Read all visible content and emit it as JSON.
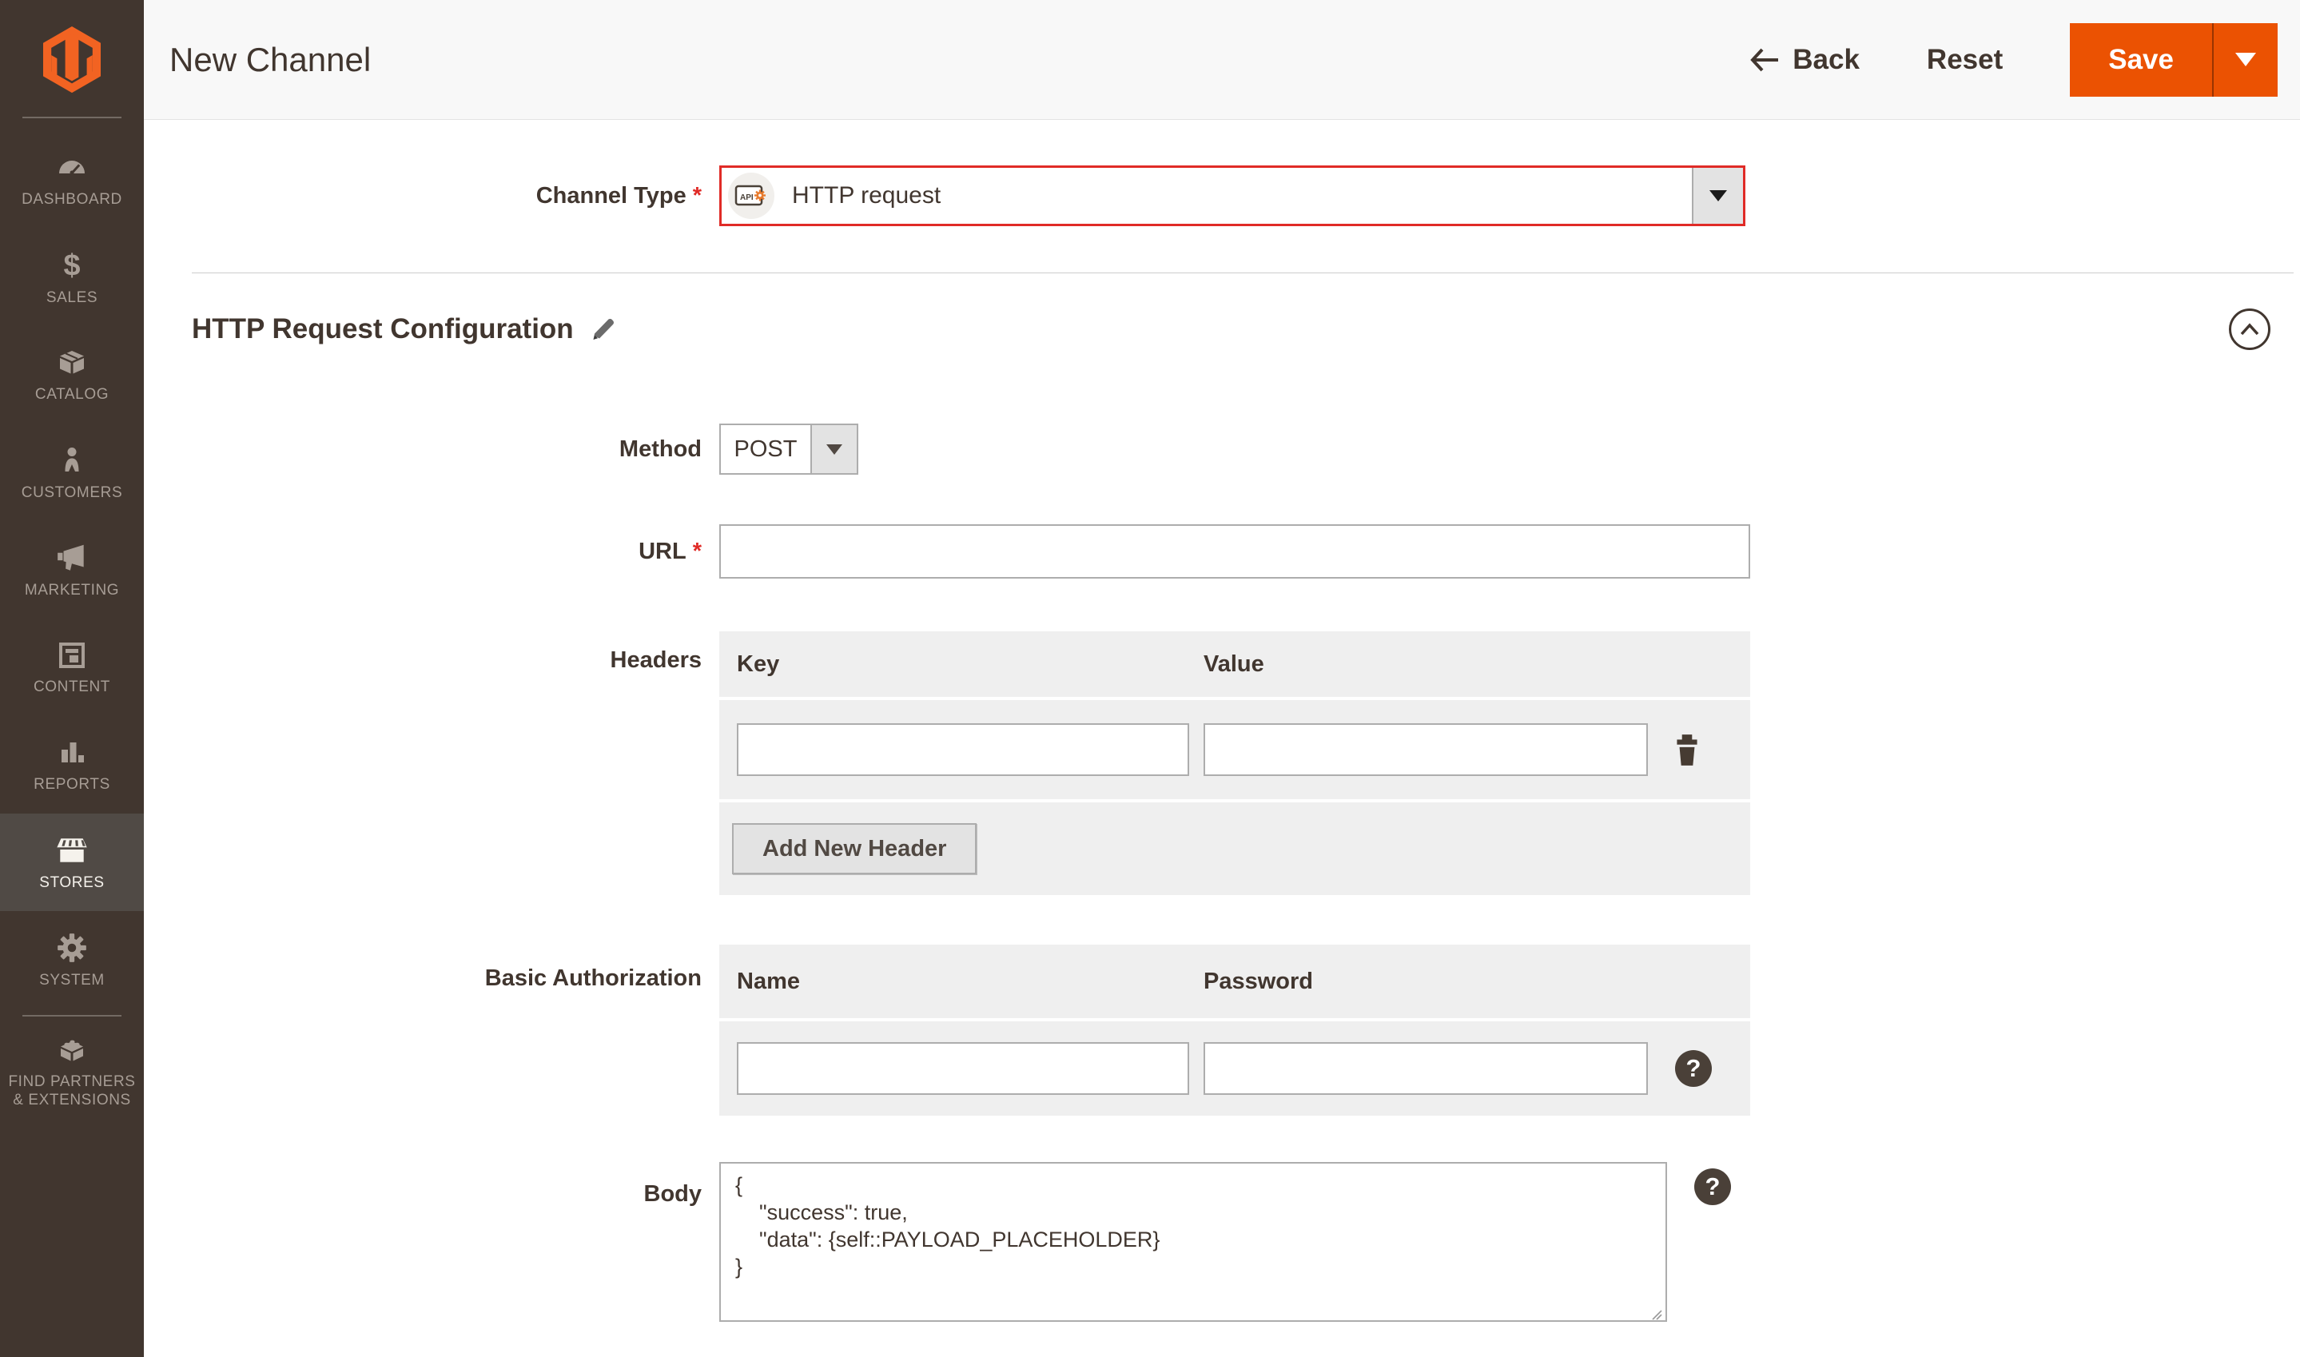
{
  "sidebar": {
    "items": [
      {
        "label": "DASHBOARD",
        "icon": "dashboard-icon",
        "active": false
      },
      {
        "label": "SALES",
        "icon": "sales-icon",
        "active": false
      },
      {
        "label": "CATALOG",
        "icon": "catalog-icon",
        "active": false
      },
      {
        "label": "CUSTOMERS",
        "icon": "customers-icon",
        "active": false
      },
      {
        "label": "MARKETING",
        "icon": "marketing-icon",
        "active": false
      },
      {
        "label": "CONTENT",
        "icon": "content-icon",
        "active": false
      },
      {
        "label": "REPORTS",
        "icon": "reports-icon",
        "active": false
      },
      {
        "label": "STORES",
        "icon": "stores-icon",
        "active": true
      },
      {
        "label": "SYSTEM",
        "icon": "system-icon",
        "active": false
      },
      {
        "label": "FIND PARTNERS & EXTENSIONS",
        "icon": "extensions-icon",
        "active": false
      }
    ]
  },
  "header": {
    "title": "New Channel",
    "back": "Back",
    "reset": "Reset",
    "save": "Save"
  },
  "form": {
    "channel_type": {
      "label": "Channel Type",
      "required": "*",
      "value": "HTTP request",
      "icon_badge": "API"
    },
    "section_title": "HTTP Request Configuration",
    "method": {
      "label": "Method",
      "value": "POST"
    },
    "url": {
      "label": "URL",
      "required": "*",
      "value": ""
    },
    "headers": {
      "label": "Headers",
      "columns": {
        "key": "Key",
        "value": "Value"
      },
      "rows": [
        {
          "key": "",
          "value": ""
        }
      ],
      "add_button": "Add New Header"
    },
    "basic_authorization": {
      "label": "Basic Authorization",
      "columns": {
        "name": "Name",
        "password": "Password"
      },
      "name_value": "",
      "password_value": "",
      "help_icon": "?"
    },
    "body": {
      "label": "Body",
      "value": "{\n    \"success\": true,\n    \"data\": {self::PAYLOAD_PLACEHOLDER}\n}",
      "help_icon": "?"
    }
  },
  "colors": {
    "accent_orange": "#eb5202",
    "logo_orange": "#f26322",
    "error_red": "#e02b27",
    "sidebar_bg": "#41362f",
    "sidebar_active_bg": "#504a45",
    "panel_gray": "#efefef",
    "header_bar": "#f8f8f8"
  }
}
